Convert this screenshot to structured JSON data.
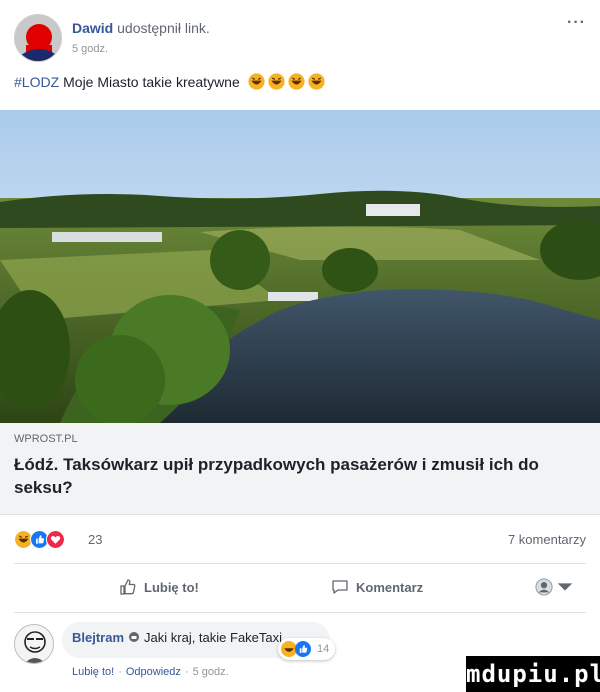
{
  "post": {
    "author": "Dawid",
    "action": "udostępnił link.",
    "time": "5 godz.",
    "more": "···",
    "hashtag": "#LODZ",
    "text": "Moje Miasto takie kreatywne"
  },
  "link": {
    "domain": "WPROST.PL",
    "title": "Łódź. Taksówkarz upił przypadkowych pasażerów i zmusił ich do seksu?"
  },
  "reactions": {
    "icons": [
      "laugh-icon",
      "like-icon",
      "love-icon"
    ],
    "count": "23",
    "comments": "7 komentarzy"
  },
  "actions": {
    "like": "Lubię to!",
    "comment": "Komentarz"
  },
  "comment": {
    "name": "Blejtram",
    "text": "Jaki kraj, takie FakeTaxi",
    "reaction_count": "14",
    "like": "Lubię to!",
    "reply": "Odpowiedz",
    "time": "5 godz."
  },
  "watermark": "mdupiu.pl",
  "colors": {
    "link_blue": "#365899",
    "meta_bg": "#f2f3f5",
    "like_blue": "#1877f2",
    "love_red": "#f02849",
    "haha_yellow": "#f7b125"
  }
}
